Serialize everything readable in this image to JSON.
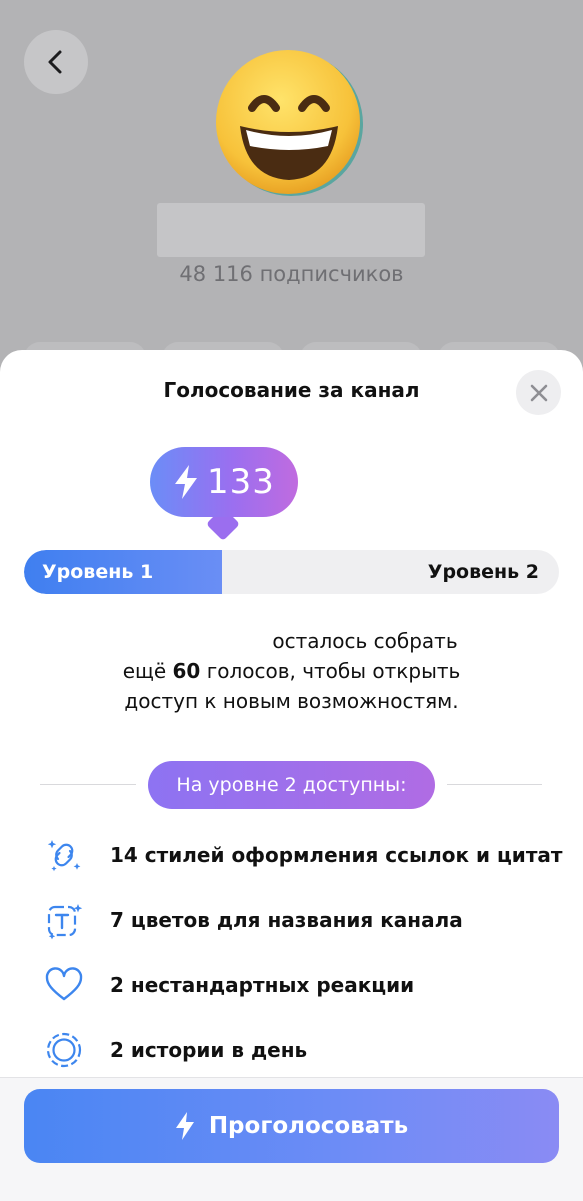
{
  "background": {
    "subscribers": "48 116 подписчиков"
  },
  "sheet": {
    "title": "Голосование за канал",
    "boost_count": "133",
    "level_current": "Уровень 1",
    "level_next": "Уровень 2",
    "progress_fraction": 0.37,
    "description": {
      "line1": "осталось собрать",
      "line2_prefix": "ещё ",
      "line2_number": "60",
      "line2_suffix": " голосов, чтобы открыть",
      "line3": "доступ к новым возможностям."
    },
    "features_title": "На уровне 2 доступны:",
    "features": [
      {
        "icon": "link-sparkle-icon",
        "label": "14 стилей оформления ссылок и цитат"
      },
      {
        "icon": "text-sparkle-icon",
        "label": "7 цветов для названия канала"
      },
      {
        "icon": "heart-icon",
        "label": "2 нестандартных реакции"
      },
      {
        "icon": "stories-icon",
        "label": "2 истории в день"
      }
    ],
    "vote_button": "Проголосовать"
  },
  "colors": {
    "accent_blue": "#3f7ff0",
    "accent_purple": "#9a6ff0",
    "icon_blue": "#3d86ee"
  }
}
